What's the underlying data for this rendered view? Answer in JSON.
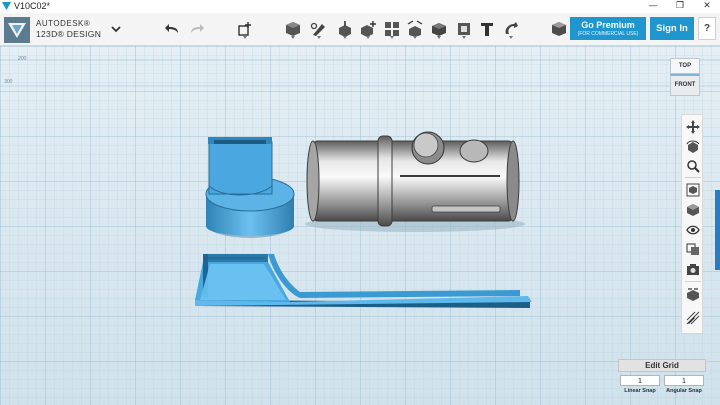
{
  "window": {
    "title": "V10C02*",
    "controls": {
      "minimize": "—",
      "maximize": "❐",
      "close": "✕"
    }
  },
  "brand": {
    "line1": "AUTODESK®",
    "line2": "123D® DESIGN"
  },
  "toolbar": {
    "tools": [
      {
        "name": "undo-icon"
      },
      {
        "name": "redo-icon"
      },
      {
        "name": "transform-icon"
      },
      {
        "name": "primitives-icon"
      },
      {
        "name": "sketch-icon"
      },
      {
        "name": "construct-icon"
      },
      {
        "name": "modify-icon"
      },
      {
        "name": "pattern-icon"
      },
      {
        "name": "group-icon"
      },
      {
        "name": "combine-icon"
      },
      {
        "name": "measure-icon"
      },
      {
        "name": "text-icon"
      },
      {
        "name": "snap-icon"
      },
      {
        "name": "material-icon"
      }
    ],
    "premium_label": "Go Premium",
    "premium_sub": "(FOR COMMERCIAL USE)",
    "signin_label": "Sign In",
    "help_label": "?"
  },
  "viewcube": {
    "top": "TOP",
    "front": "FRONT"
  },
  "grid_ruler": {
    "a": "200",
    "b": "300"
  },
  "navbar": {
    "items": [
      {
        "name": "pan-icon"
      },
      {
        "name": "orbit-icon"
      },
      {
        "name": "zoom-icon"
      },
      {
        "name": "fit-icon"
      },
      {
        "name": "perspective-icon"
      },
      {
        "name": "visibility-icon"
      },
      {
        "name": "materials-outlines-icon"
      },
      {
        "name": "snapshot-icon"
      },
      {
        "name": "grid-settings-icon"
      },
      {
        "name": "edit-grid-icon"
      }
    ]
  },
  "edit_grid": {
    "title": "Edit Grid",
    "linear_value": "1",
    "angular_value": "1",
    "linear_label": "Linear Snap",
    "angular_label": "Angular Snap"
  },
  "colors": {
    "accent": "#1f96cd",
    "selected_part": "#4aa8e0",
    "grid_bg": "#c8dce8",
    "grid_line": "#a9c6d6"
  }
}
